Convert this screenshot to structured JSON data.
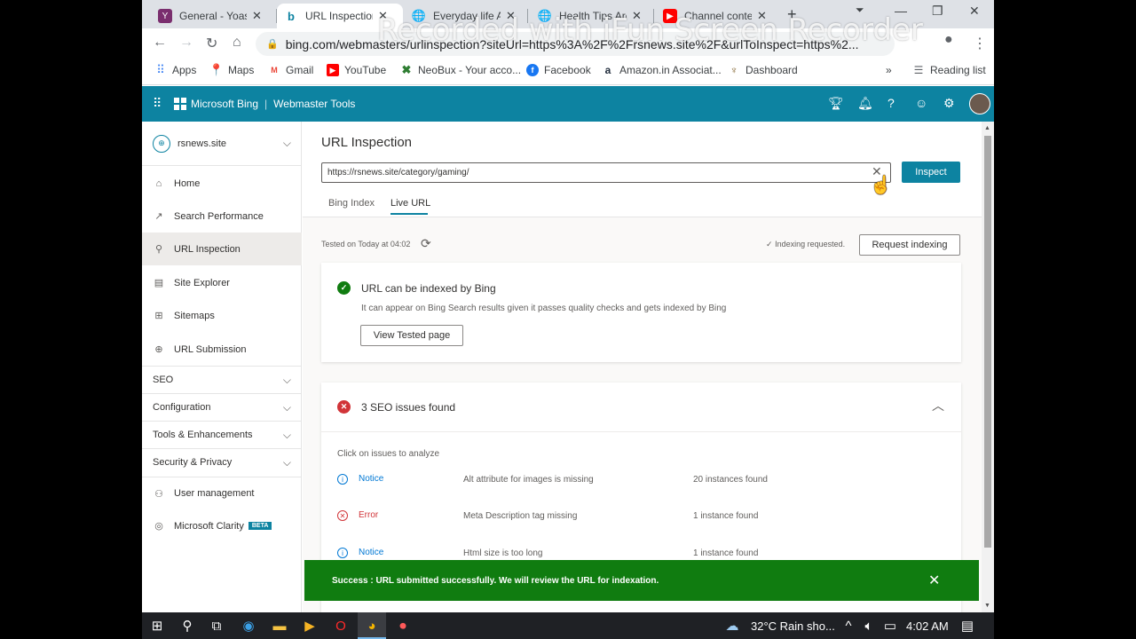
{
  "browser": {
    "tabs": [
      {
        "title": "General - Yoast SEO",
        "color": "#7a2e6e"
      },
      {
        "title": "URL Inspection - Bing",
        "color": "#0d83a1"
      },
      {
        "title": "Everyday life Archives",
        "color": "#5f6368"
      },
      {
        "title": "Health Tips Archives",
        "color": "#5f6368"
      },
      {
        "title": "Channel content - YouTube",
        "color": "#ff0000"
      }
    ],
    "url": "bing.com/webmasters/urlinspection?siteUrl=https%3A%2F%2Frsnews.site%2F&urlToInspect=https%2...",
    "watermark": "Recorded with iFun Screen Recorder",
    "bookmarks": [
      {
        "label": "Apps",
        "icon": "apps-icon",
        "color": "#4285f4"
      },
      {
        "label": "Maps",
        "icon": "maps-icon",
        "color": "#34a853"
      },
      {
        "label": "Gmail",
        "icon": "gmail-icon",
        "color": "#ea4335"
      },
      {
        "label": "YouTube",
        "icon": "youtube-icon",
        "color": "#ff0000"
      },
      {
        "label": "NeoBux - Your acco...",
        "icon": "neobux-icon",
        "color": "#2e7d32"
      },
      {
        "label": "Facebook",
        "icon": "facebook-icon",
        "color": "#1877f2"
      },
      {
        "label": "Amazon.in Associat...",
        "icon": "amazon-icon",
        "color": "#232f3e"
      },
      {
        "label": "Dashboard",
        "icon": "dashboard-icon",
        "color": "#8a6d3b"
      }
    ],
    "more_bookmarks": "»",
    "reading_list": "Reading list"
  },
  "bing": {
    "brand": "Microsoft Bing",
    "product": "Webmaster Tools",
    "accent": "#0d83a1"
  },
  "sidebar": {
    "site": "rsnews.site",
    "items": [
      {
        "label": "Home",
        "icon": "home-icon"
      },
      {
        "label": "Search Performance",
        "icon": "trend-icon"
      },
      {
        "label": "URL Inspection",
        "icon": "search-icon"
      },
      {
        "label": "Site Explorer",
        "icon": "document-icon"
      },
      {
        "label": "Sitemaps",
        "icon": "sitemap-icon"
      },
      {
        "label": "URL Submission",
        "icon": "globe-icon"
      }
    ],
    "groups": [
      "SEO",
      "Configuration",
      "Tools & Enhancements",
      "Security & Privacy"
    ],
    "bottom_items": [
      {
        "label": "User management",
        "icon": "user-icon"
      },
      {
        "label": "Microsoft Clarity",
        "icon": "clarity-icon",
        "badge": "BETA"
      }
    ]
  },
  "main": {
    "title": "URL Inspection",
    "url_value": "https://rsnews.site/category/gaming/",
    "inspect_label": "Inspect",
    "tabs": [
      "Bing Index",
      "Live URL"
    ],
    "tested_text": "Tested on Today at 04:02",
    "indexing_status": "Indexing requested.",
    "request_label": "Request indexing",
    "index_card": {
      "title": "URL can be indexed by Bing",
      "desc": "It can appear on Bing Search results given it passes quality checks and gets indexed by Bing",
      "button": "View Tested page"
    },
    "seo_card": {
      "title": "3 SEO issues found",
      "hint": "Click on issues to analyze",
      "issues": [
        {
          "severity": "Notice",
          "desc": "Alt attribute for images is missing",
          "count": "20 instances found"
        },
        {
          "severity": "Error",
          "desc": "Meta Description tag missing",
          "count": "1 instance found"
        },
        {
          "severity": "Notice",
          "desc": "Html size is too long",
          "count": "1 instance found"
        }
      ]
    },
    "toast": "Success : URL submitted successfully. We will review the URL for indexation."
  },
  "taskbar": {
    "weather": "32°C  Rain sho...",
    "time": "4:02 AM"
  }
}
